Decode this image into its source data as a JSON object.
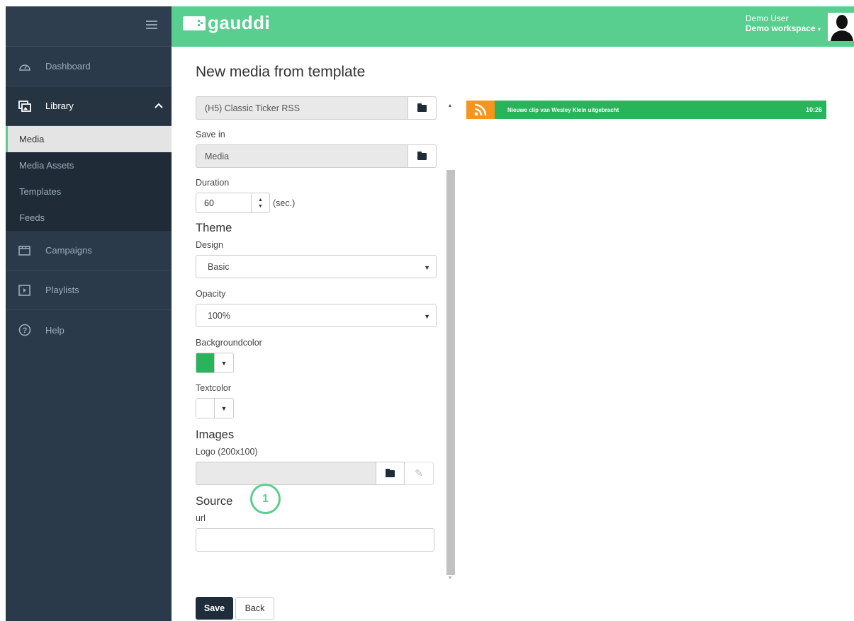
{
  "app": {
    "logo_text": "gauddi"
  },
  "header": {
    "user_name": "Demo User",
    "workspace": "Demo workspace"
  },
  "sidebar": {
    "items": [
      {
        "label": "Dashboard",
        "icon": "dashboard-gauge-icon"
      },
      {
        "label": "Library",
        "icon": "library-images-icon",
        "expanded": true,
        "children": [
          {
            "label": "Media",
            "selected": true
          },
          {
            "label": "Media Assets"
          },
          {
            "label": "Templates"
          },
          {
            "label": "Feeds"
          }
        ]
      },
      {
        "label": "Campaigns",
        "icon": "campaigns-clapper-icon"
      },
      {
        "label": "Playlists",
        "icon": "playlists-film-icon"
      },
      {
        "label": "Help",
        "icon": "help-circle-icon"
      }
    ]
  },
  "page": {
    "title": "New media from template"
  },
  "form": {
    "template_value": "(H5) Classic Ticker RSS",
    "save_in_label": "Save in",
    "save_in_value": "Media",
    "duration_label": "Duration",
    "duration_value": "60",
    "duration_unit": "(sec.)",
    "theme_title": "Theme",
    "design_label": "Design",
    "design_value": "Basic",
    "opacity_label": "Opacity",
    "opacity_value": "100%",
    "bgcolor_label": "Backgroundcolor",
    "bgcolor_value": "#29b35a",
    "textcolor_label": "Textcolor",
    "textcolor_value": "#ffffff",
    "images_title": "Images",
    "logo_label": "Logo (200x100)",
    "logo_marker": "1",
    "source_title": "Source",
    "url_label": "url",
    "url_value": ""
  },
  "buttons": {
    "save": "Save",
    "back": "Back"
  },
  "preview": {
    "ticker_text": "Nieuwe clip van Wesley Klein uitgebracht",
    "time": "10:26"
  },
  "colors": {
    "header": "#58cf8e",
    "sidebar": "#2b3a4a",
    "accent": "#5ccd8f",
    "rss": "#f7941d"
  }
}
